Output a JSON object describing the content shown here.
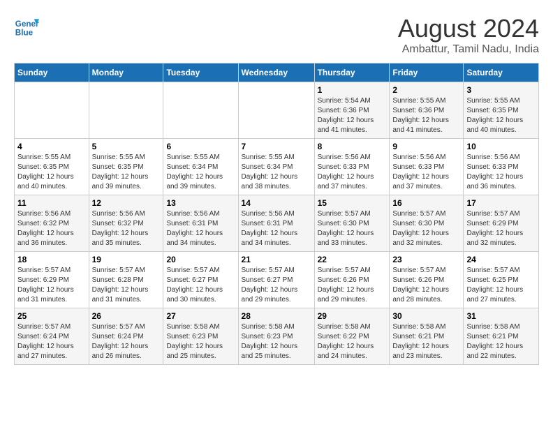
{
  "logo": {
    "line1": "General",
    "line2": "Blue"
  },
  "title": "August 2024",
  "subtitle": "Ambattur, Tamil Nadu, India",
  "days_of_week": [
    "Sunday",
    "Monday",
    "Tuesday",
    "Wednesday",
    "Thursday",
    "Friday",
    "Saturday"
  ],
  "weeks": [
    [
      {
        "day": "",
        "info": ""
      },
      {
        "day": "",
        "info": ""
      },
      {
        "day": "",
        "info": ""
      },
      {
        "day": "",
        "info": ""
      },
      {
        "day": "1",
        "info": "Sunrise: 5:54 AM\nSunset: 6:36 PM\nDaylight: 12 hours and 41 minutes."
      },
      {
        "day": "2",
        "info": "Sunrise: 5:55 AM\nSunset: 6:36 PM\nDaylight: 12 hours and 41 minutes."
      },
      {
        "day": "3",
        "info": "Sunrise: 5:55 AM\nSunset: 6:35 PM\nDaylight: 12 hours and 40 minutes."
      }
    ],
    [
      {
        "day": "4",
        "info": "Sunrise: 5:55 AM\nSunset: 6:35 PM\nDaylight: 12 hours and 40 minutes."
      },
      {
        "day": "5",
        "info": "Sunrise: 5:55 AM\nSunset: 6:35 PM\nDaylight: 12 hours and 39 minutes."
      },
      {
        "day": "6",
        "info": "Sunrise: 5:55 AM\nSunset: 6:34 PM\nDaylight: 12 hours and 39 minutes."
      },
      {
        "day": "7",
        "info": "Sunrise: 5:55 AM\nSunset: 6:34 PM\nDaylight: 12 hours and 38 minutes."
      },
      {
        "day": "8",
        "info": "Sunrise: 5:56 AM\nSunset: 6:33 PM\nDaylight: 12 hours and 37 minutes."
      },
      {
        "day": "9",
        "info": "Sunrise: 5:56 AM\nSunset: 6:33 PM\nDaylight: 12 hours and 37 minutes."
      },
      {
        "day": "10",
        "info": "Sunrise: 5:56 AM\nSunset: 6:33 PM\nDaylight: 12 hours and 36 minutes."
      }
    ],
    [
      {
        "day": "11",
        "info": "Sunrise: 5:56 AM\nSunset: 6:32 PM\nDaylight: 12 hours and 36 minutes."
      },
      {
        "day": "12",
        "info": "Sunrise: 5:56 AM\nSunset: 6:32 PM\nDaylight: 12 hours and 35 minutes."
      },
      {
        "day": "13",
        "info": "Sunrise: 5:56 AM\nSunset: 6:31 PM\nDaylight: 12 hours and 34 minutes."
      },
      {
        "day": "14",
        "info": "Sunrise: 5:56 AM\nSunset: 6:31 PM\nDaylight: 12 hours and 34 minutes."
      },
      {
        "day": "15",
        "info": "Sunrise: 5:57 AM\nSunset: 6:30 PM\nDaylight: 12 hours and 33 minutes."
      },
      {
        "day": "16",
        "info": "Sunrise: 5:57 AM\nSunset: 6:30 PM\nDaylight: 12 hours and 32 minutes."
      },
      {
        "day": "17",
        "info": "Sunrise: 5:57 AM\nSunset: 6:29 PM\nDaylight: 12 hours and 32 minutes."
      }
    ],
    [
      {
        "day": "18",
        "info": "Sunrise: 5:57 AM\nSunset: 6:29 PM\nDaylight: 12 hours and 31 minutes."
      },
      {
        "day": "19",
        "info": "Sunrise: 5:57 AM\nSunset: 6:28 PM\nDaylight: 12 hours and 31 minutes."
      },
      {
        "day": "20",
        "info": "Sunrise: 5:57 AM\nSunset: 6:27 PM\nDaylight: 12 hours and 30 minutes."
      },
      {
        "day": "21",
        "info": "Sunrise: 5:57 AM\nSunset: 6:27 PM\nDaylight: 12 hours and 29 minutes."
      },
      {
        "day": "22",
        "info": "Sunrise: 5:57 AM\nSunset: 6:26 PM\nDaylight: 12 hours and 29 minutes."
      },
      {
        "day": "23",
        "info": "Sunrise: 5:57 AM\nSunset: 6:26 PM\nDaylight: 12 hours and 28 minutes."
      },
      {
        "day": "24",
        "info": "Sunrise: 5:57 AM\nSunset: 6:25 PM\nDaylight: 12 hours and 27 minutes."
      }
    ],
    [
      {
        "day": "25",
        "info": "Sunrise: 5:57 AM\nSunset: 6:24 PM\nDaylight: 12 hours and 27 minutes."
      },
      {
        "day": "26",
        "info": "Sunrise: 5:57 AM\nSunset: 6:24 PM\nDaylight: 12 hours and 26 minutes."
      },
      {
        "day": "27",
        "info": "Sunrise: 5:58 AM\nSunset: 6:23 PM\nDaylight: 12 hours and 25 minutes."
      },
      {
        "day": "28",
        "info": "Sunrise: 5:58 AM\nSunset: 6:23 PM\nDaylight: 12 hours and 25 minutes."
      },
      {
        "day": "29",
        "info": "Sunrise: 5:58 AM\nSunset: 6:22 PM\nDaylight: 12 hours and 24 minutes."
      },
      {
        "day": "30",
        "info": "Sunrise: 5:58 AM\nSunset: 6:21 PM\nDaylight: 12 hours and 23 minutes."
      },
      {
        "day": "31",
        "info": "Sunrise: 5:58 AM\nSunset: 6:21 PM\nDaylight: 12 hours and 22 minutes."
      }
    ]
  ]
}
